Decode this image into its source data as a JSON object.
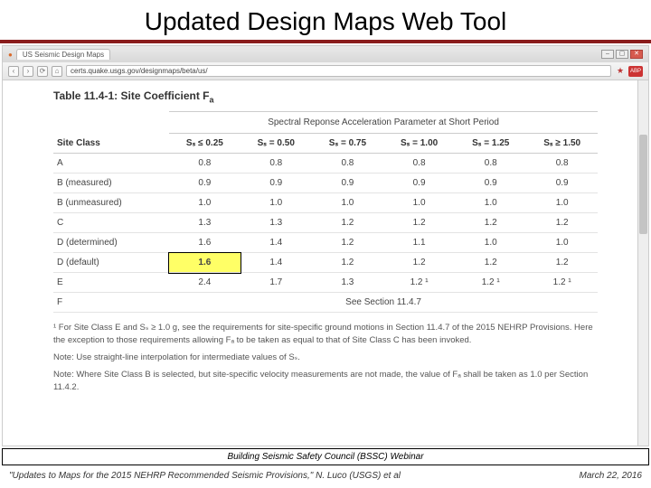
{
  "slide": {
    "title": "Updated Design Maps Web Tool"
  },
  "browser": {
    "tab_title": "US Seismic Design Maps",
    "url": "certs.quake.usgs.gov/designmaps/beta/us/",
    "window_controls": {
      "min": "–",
      "max": "▢",
      "close": "✕"
    },
    "nav": {
      "back": "‹",
      "fwd": "›",
      "reload": "⟳",
      "home": "⌂"
    }
  },
  "table": {
    "title_prefix": "Table 11.4-1: Site Coefficient ",
    "title_symbol": "F",
    "title_sub": "a",
    "span_header": "Spectral Reponse Acceleration Parameter at Short Period",
    "col0": "Site Class",
    "cols": [
      "Sₛ ≤ 0.25",
      "Sₛ = 0.50",
      "Sₛ = 0.75",
      "Sₛ = 1.00",
      "Sₛ = 1.25",
      "Sₛ ≥ 1.50"
    ],
    "rows": [
      {
        "label": "A",
        "vals": [
          "0.8",
          "0.8",
          "0.8",
          "0.8",
          "0.8",
          "0.8"
        ]
      },
      {
        "label": "B (measured)",
        "vals": [
          "0.9",
          "0.9",
          "0.9",
          "0.9",
          "0.9",
          "0.9"
        ]
      },
      {
        "label": "B (unmeasured)",
        "vals": [
          "1.0",
          "1.0",
          "1.0",
          "1.0",
          "1.0",
          "1.0"
        ]
      },
      {
        "label": "C",
        "vals": [
          "1.3",
          "1.3",
          "1.2",
          "1.2",
          "1.2",
          "1.2"
        ]
      },
      {
        "label": "D (determined)",
        "vals": [
          "1.6",
          "1.4",
          "1.2",
          "1.1",
          "1.0",
          "1.0"
        ]
      },
      {
        "label": "D (default)",
        "vals": [
          "1.6",
          "1.4",
          "1.2",
          "1.2",
          "1.2",
          "1.2"
        ]
      },
      {
        "label": "E",
        "vals": [
          "2.4",
          "1.7",
          "1.3",
          "1.2 ¹",
          "1.2 ¹",
          "1.2 ¹"
        ]
      },
      {
        "label": "F",
        "vals": [
          "See Section 11.4.7"
        ],
        "span": true
      }
    ],
    "highlight": {
      "row": 5,
      "col": 0
    }
  },
  "notes": {
    "n1": "¹ For Site Class E and Sₛ ≥ 1.0 g, see the requirements for site-specific ground motions in Section 11.4.7 of the 2015 NEHRP Provisions. Here the exception to those requirements allowing Fₐ to be taken as equal to that of Site Class C has been invoked.",
    "n2": "Note: Use straight-line interpolation for intermediate values of Sₛ.",
    "n3": "Note: Where Site Class B is selected, but site-specific velocity measurements are not made, the value of Fₐ shall be taken as 1.0 per Section 11.4.2."
  },
  "ribbon": "Building Seismic Safety Council (BSSC) Webinar",
  "footer": {
    "left": "\"Updates to Maps for the 2015 NEHRP Recommended Seismic Provisions,\" N. Luco (USGS) et al",
    "right": "March 22, 2016"
  },
  "chart_data": {
    "type": "table",
    "title": "Table 11.4-1: Site Coefficient Fa",
    "xlabel": "Spectral Response Acceleration Parameter at Short Period (Ss)",
    "ylabel": "Site Class",
    "categories": [
      "Ss ≤ 0.25",
      "Ss = 0.50",
      "Ss = 0.75",
      "Ss = 1.00",
      "Ss = 1.25",
      "Ss ≥ 1.50"
    ],
    "series": [
      {
        "name": "A",
        "values": [
          0.8,
          0.8,
          0.8,
          0.8,
          0.8,
          0.8
        ]
      },
      {
        "name": "B (measured)",
        "values": [
          0.9,
          0.9,
          0.9,
          0.9,
          0.9,
          0.9
        ]
      },
      {
        "name": "B (unmeasured)",
        "values": [
          1.0,
          1.0,
          1.0,
          1.0,
          1.0,
          1.0
        ]
      },
      {
        "name": "C",
        "values": [
          1.3,
          1.3,
          1.2,
          1.2,
          1.2,
          1.2
        ]
      },
      {
        "name": "D (determined)",
        "values": [
          1.6,
          1.4,
          1.2,
          1.1,
          1.0,
          1.0
        ]
      },
      {
        "name": "D (default)",
        "values": [
          1.6,
          1.4,
          1.2,
          1.2,
          1.2,
          1.2
        ]
      },
      {
        "name": "E",
        "values": [
          2.4,
          1.7,
          1.3,
          1.2,
          1.2,
          1.2
        ]
      },
      {
        "name": "F",
        "values": [
          "See Section 11.4.7"
        ]
      }
    ]
  }
}
